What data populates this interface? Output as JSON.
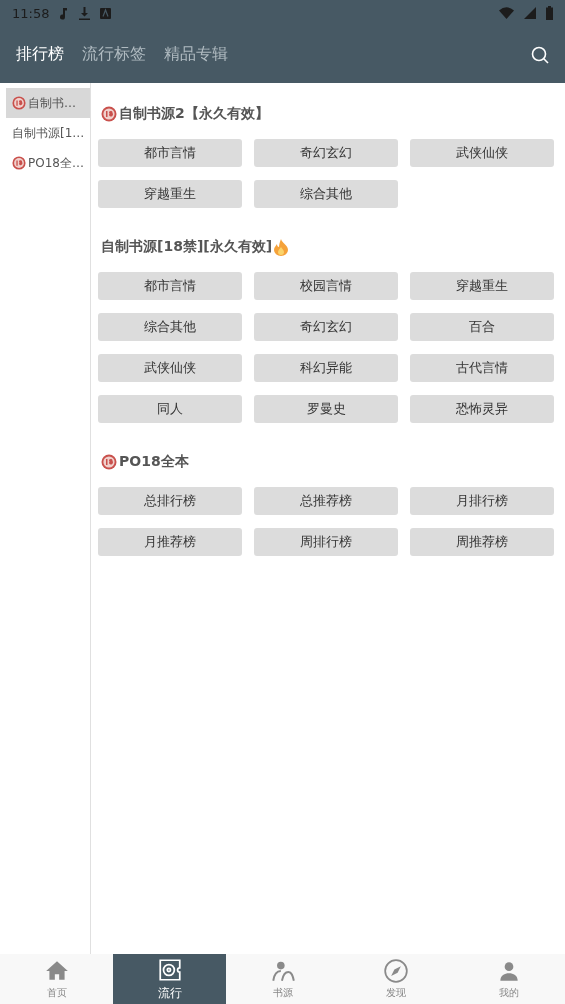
{
  "status_bar": {
    "time": "11:58"
  },
  "tabs": [
    {
      "label": "排行榜",
      "selected": true
    },
    {
      "label": "流行标签",
      "selected": false
    },
    {
      "label": "精品专辑",
      "selected": false
    }
  ],
  "sidebar": {
    "items": [
      {
        "label": "自制书…",
        "badge18": true,
        "selected": true
      },
      {
        "label": "自制书源[1…",
        "badge18": false,
        "selected": false
      },
      {
        "label": "PO18全…",
        "badge18": true,
        "selected": false
      }
    ]
  },
  "sections": [
    {
      "title": "自制书源2【永久有效】",
      "badge18": true,
      "fire": false,
      "items": [
        "都市言情",
        "奇幻玄幻",
        "武侠仙侠",
        "穿越重生",
        "综合其他"
      ]
    },
    {
      "title": "自制书源[18禁][永久有效]",
      "badge18": false,
      "fire": true,
      "items": [
        "都市言情",
        "校园言情",
        "穿越重生",
        "综合其他",
        "奇幻玄幻",
        "百合",
        "武侠仙侠",
        "科幻异能",
        "古代言情",
        "同人",
        "罗曼史",
        "恐怖灵异"
      ]
    },
    {
      "title": "PO18全本",
      "badge18": true,
      "fire": false,
      "items": [
        "总排行榜",
        "总推荐榜",
        "月排行榜",
        "月推荐榜",
        "周排行榜",
        "周推荐榜"
      ]
    }
  ],
  "bottom_nav": [
    {
      "label": "首页",
      "kind": "home",
      "selected": false
    },
    {
      "label": "流行",
      "kind": "disc",
      "selected": true
    },
    {
      "label": "书源",
      "kind": "person",
      "selected": false
    },
    {
      "label": "发现",
      "kind": "compass",
      "selected": false
    },
    {
      "label": "我的",
      "kind": "user",
      "selected": false
    }
  ]
}
